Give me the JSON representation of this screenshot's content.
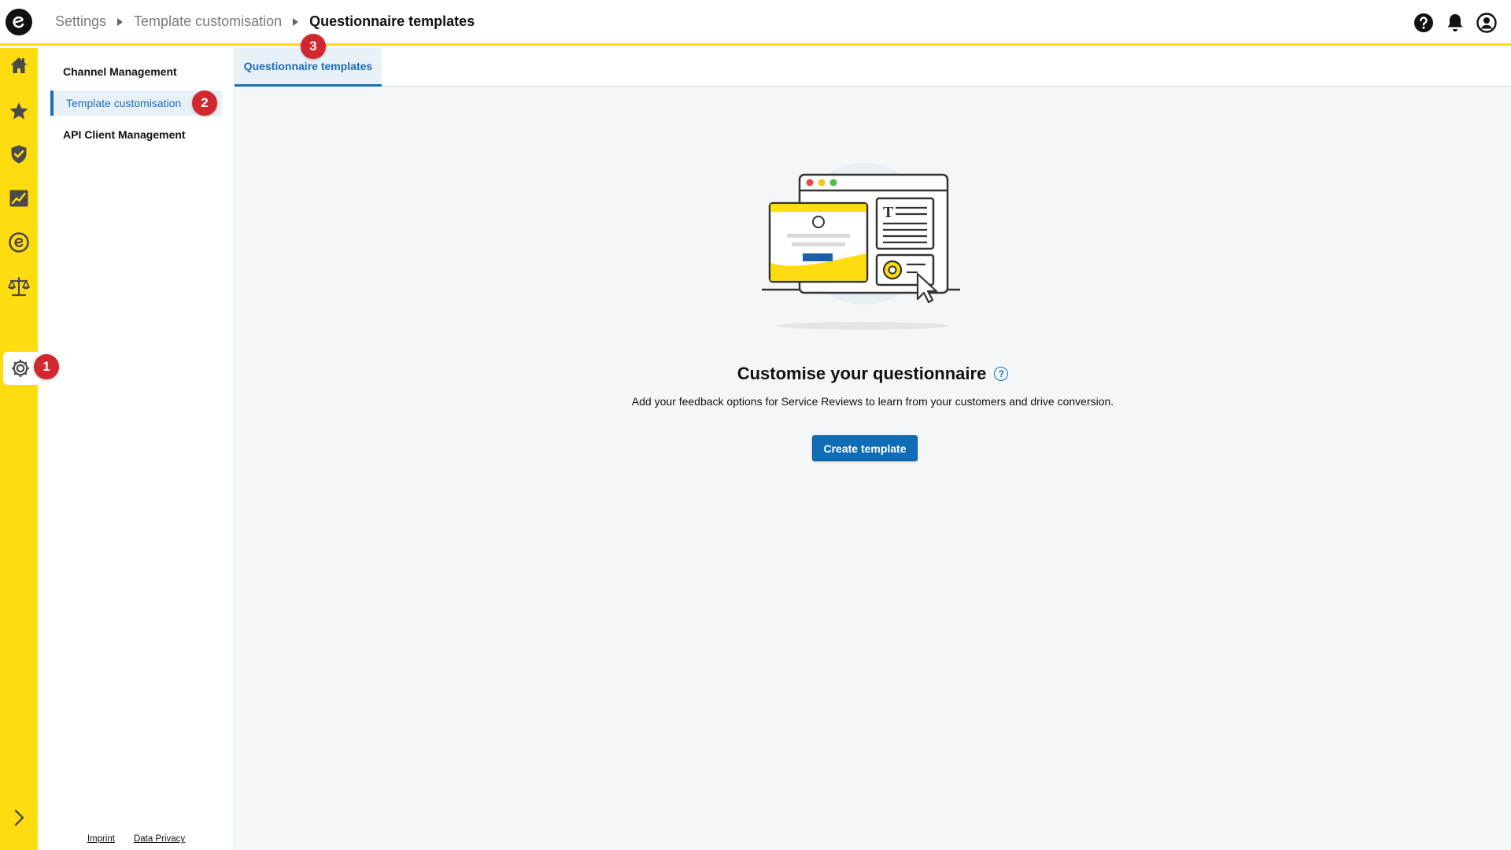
{
  "header": {
    "breadcrumb": [
      "Settings",
      "Template customisation",
      "Questionnaire templates"
    ],
    "icons": [
      "help-icon",
      "bell-icon",
      "account-icon"
    ]
  },
  "rail": {
    "items": [
      "home-icon",
      "star-icon",
      "shield-check-icon",
      "chart-icon",
      "trusted-logo-icon",
      "scales-icon",
      "gear-icon",
      "chevron-right-icon"
    ]
  },
  "subnav": {
    "items": [
      {
        "label": "Channel Management"
      },
      {
        "label": "Template customisation"
      },
      {
        "label": "API Client Management"
      }
    ],
    "footer": {
      "imprint": "Imprint",
      "privacy": "Data Privacy"
    }
  },
  "tabs": [
    {
      "label": "Questionnaire templates"
    }
  ],
  "empty_state": {
    "title": "Customise your questionnaire",
    "help": "?",
    "description": "Add your feedback options for Service Reviews to learn from your customers and drive conversion.",
    "button": "Create template"
  },
  "badges": [
    "1",
    "2",
    "3"
  ],
  "colors": {
    "brand_yellow": "#ffdc0f",
    "accent_blue": "#1a6db5",
    "badge_red": "#d0282e"
  }
}
